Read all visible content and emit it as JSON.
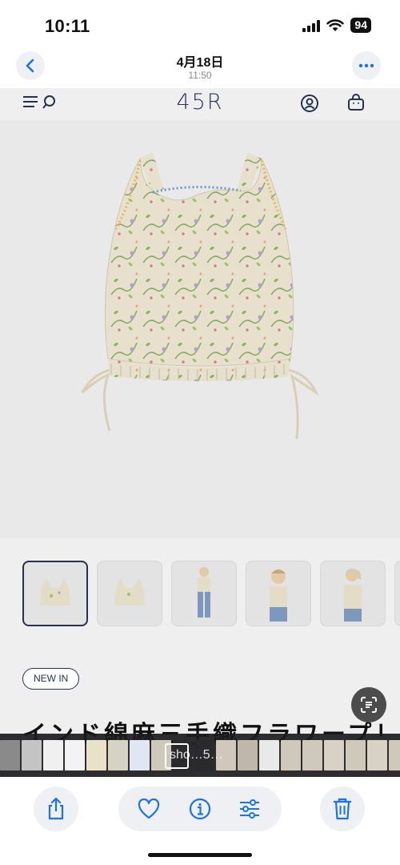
{
  "status": {
    "time": "10:11",
    "battery": "94"
  },
  "photos_header": {
    "date": "4月18日",
    "time": "11:50"
  },
  "site": {
    "logo": "45R"
  },
  "product": {
    "badge": "NEW IN",
    "title": "インド綿麻三手織フラワープリント"
  },
  "scrubber": {
    "text": "sho…5…"
  },
  "colors": {
    "accent": "#1a73e8",
    "navy": "#24324f",
    "background": "#efefef"
  },
  "icons": [
    "chevron-left-icon",
    "ellipsis-icon",
    "menu-icon",
    "search-icon",
    "user-icon",
    "bag-icon",
    "visual-lookup-icon",
    "share-icon",
    "heart-icon",
    "info-icon",
    "adjust-icon",
    "trash-icon"
  ]
}
